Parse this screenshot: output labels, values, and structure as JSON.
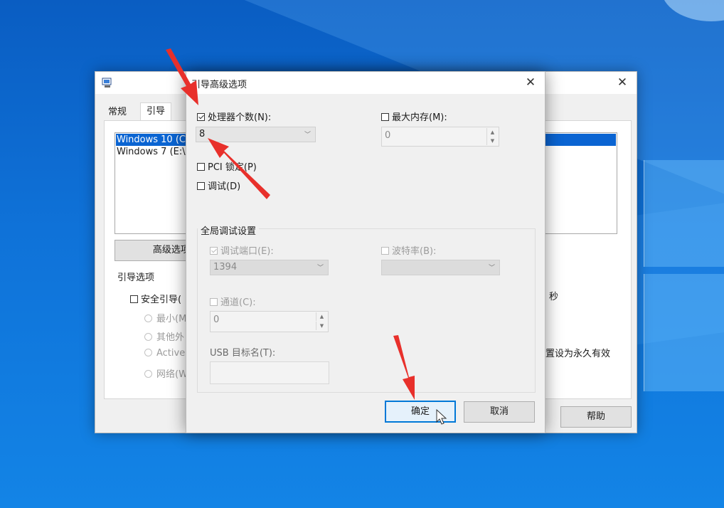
{
  "background": {
    "accent": "#0f72d8"
  },
  "main_window": {
    "tabs": [
      "常规",
      "引导"
    ],
    "boot_list": [
      "Windows 10 (C:",
      "Windows 7 (E:\\"
    ],
    "advanced_button": "高级选项(",
    "boot_options_title": "引导选项",
    "safe_boot_label": "安全引导(",
    "safe_boot_radios": [
      "最小(M",
      "其他外",
      "Active",
      "网络(W"
    ],
    "seconds_label": "秒",
    "permanent_label": "置设为永久有效",
    "help_button": "帮助"
  },
  "dialog": {
    "title": "引导高级选项",
    "processor_count": {
      "label": "处理器个数(N):",
      "checked": true,
      "value": "8"
    },
    "max_memory": {
      "label": "最大内存(M):",
      "checked": false,
      "value": "0"
    },
    "pci_lock": {
      "label": "PCI 锁定(P)",
      "checked": false
    },
    "debug": {
      "label": "调试(D)",
      "checked": false
    },
    "global_debug": {
      "title": "全局调试设置",
      "debug_port": {
        "label": "调试端口(E):",
        "value": "1394"
      },
      "baud_rate": {
        "label": "波特率(B):",
        "value": ""
      },
      "channel": {
        "label": "通道(C):",
        "value": "0"
      },
      "usb_target": {
        "label": "USB 目标名(T):",
        "value": ""
      }
    },
    "ok_button": "确定",
    "cancel_button": "取消"
  },
  "annotation_color": "#e8302b"
}
